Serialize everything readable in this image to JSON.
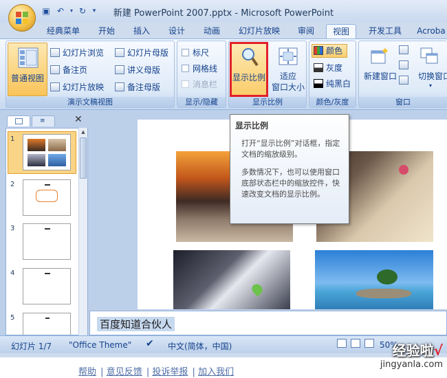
{
  "title": "新建 PowerPoint 2007.pptx - Microsoft PowerPoint",
  "tabs": [
    "经典菜单",
    "开始",
    "插入",
    "设计",
    "动画",
    "幻灯片放映",
    "审阅",
    "视图",
    "开发工具",
    "Acroba"
  ],
  "active_tab": "视图",
  "ribbon": {
    "presentation_views": {
      "normal": "普通视图",
      "slide_sorter": "幻灯片浏览",
      "notes_page": "备注页",
      "slide_show": "幻灯片放映",
      "slide_master": "幻灯片母版",
      "handout_master": "讲义母版",
      "notes_master": "备注母版",
      "group_label": "演示文稿视图"
    },
    "show_hide": {
      "ruler": "标尺",
      "gridlines": "网格线",
      "message_bar": "消息栏",
      "group_label": "显示/隐藏"
    },
    "zoom": {
      "zoom_button": "显示比例",
      "fit_line1": "适应",
      "fit_line2": "窗口大小",
      "group_label": "显示比例"
    },
    "color": {
      "color": "颜色",
      "grayscale": "灰度",
      "pure_bw": "纯黑白",
      "group_label": "颜色/灰度"
    },
    "window": {
      "new_window": "新建窗口",
      "switch_window": "切换窗口",
      "group_label": "窗口"
    }
  },
  "tooltip": {
    "title": "显示比例",
    "para1": "打开“显示比例”对话框，指定文档的缩放级别。",
    "para2": "多数情况下，也可以使用窗口底部状态栏中的缩放控件，快速改变文档的显示比例。"
  },
  "slides_panel": {
    "numbers": [
      "1",
      "2",
      "3",
      "4",
      "5"
    ],
    "selected": 1
  },
  "notes": "百度知道合伙人",
  "statusbar": {
    "slide_info": "幻灯片 1/7",
    "theme": "\"Office Theme\"",
    "language": "中文(简体，中国)",
    "zoom": "50%"
  },
  "footer": {
    "links": [
      "帮助",
      "意见反馈",
      "投诉举报",
      "加入我们"
    ],
    "separator": "|"
  },
  "watermark": {
    "main": "经验啦",
    "check": "√",
    "sub": "jingyanla.com"
  },
  "colors": {
    "highlight_box": "#e0202a",
    "selected_button": "#fbcd6b",
    "ribbon_bg": "#dbe7f6",
    "accent_text": "#15428b"
  }
}
